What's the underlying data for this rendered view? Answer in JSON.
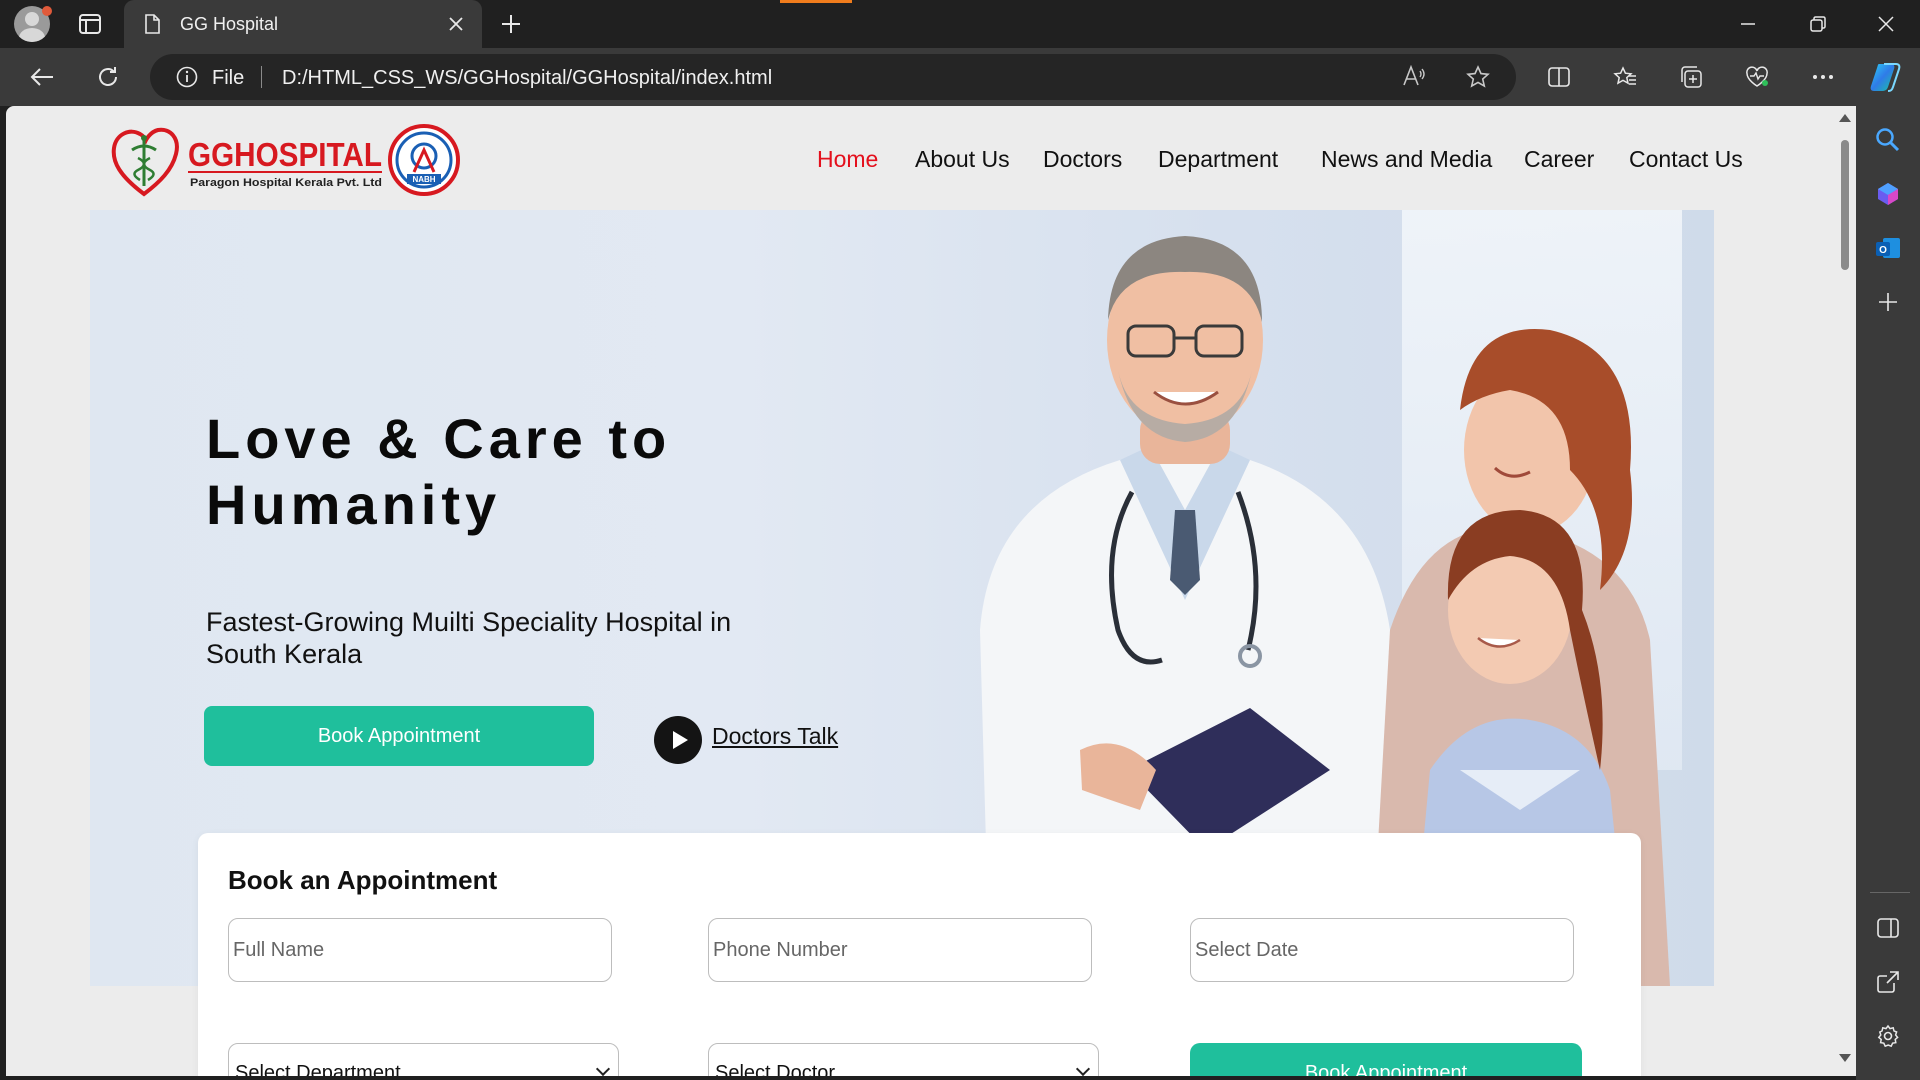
{
  "browser": {
    "tab_title": "GG Hospital",
    "address_scheme": "File",
    "address_url": "D:/HTML_CSS_WS/GGHospital/GGHospital/index.html"
  },
  "site": {
    "logo": {
      "name": "GGHOSPITAL",
      "tagline": "Paragon Hospital Kerala Pvt. Ltd",
      "badge_text": "NABH"
    },
    "nav": [
      "Home",
      "About Us",
      "Doctors",
      "Department",
      "News and Media",
      "Career",
      "Contact Us"
    ],
    "active_nav": "Home",
    "colors": {
      "accent": "#1fbf9c",
      "nav_active": "#e4101d",
      "brand_red": "#d71920"
    },
    "hero": {
      "title": "Love & Care to Humanity",
      "subtitle": "Fastest-Growing Muilti Speciality Hospital in South Kerala",
      "book_button": "Book Appointment",
      "doctors_talk": "Doctors Talk"
    },
    "appointment": {
      "title": "Book an Appointment",
      "name_placeholder": "Full Name",
      "phone_placeholder": "Phone Number",
      "date_placeholder": "Select Date",
      "department_select": "Select Department",
      "doctor_select": "Select Doctor",
      "submit_button": "Book Appointment"
    }
  }
}
